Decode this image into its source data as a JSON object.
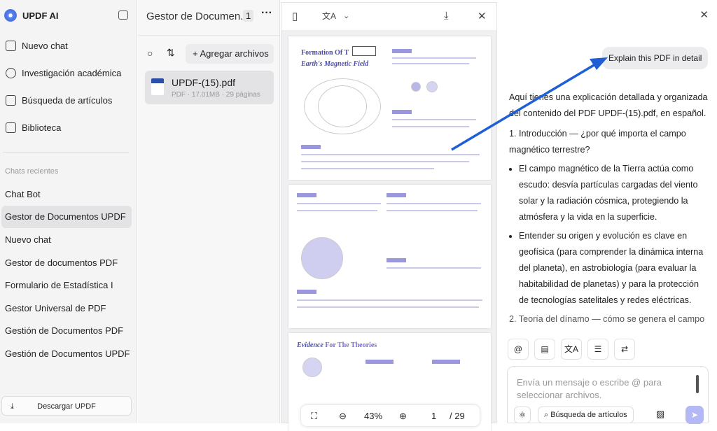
{
  "app": {
    "name": "UPDF AI"
  },
  "nav": [
    {
      "label": "Nuevo chat",
      "icon": "edit-icon"
    },
    {
      "label": "Investigación académica",
      "icon": "telescope-icon"
    },
    {
      "label": "Búsqueda de artículos",
      "icon": "search-doc-icon"
    },
    {
      "label": "Biblioteca",
      "icon": "library-icon"
    }
  ],
  "recent_heading": "Chats recientes",
  "recent": [
    "Chat Bot",
    "Gestor de Documentos UPDF",
    "Nuevo chat",
    "Gestor de documentos PDF",
    "Formulario de Estadística I",
    "Gestor Universal de PDF",
    "Gestión de Documentos PDF",
    "Gestión de Documentos UPDF"
  ],
  "download": "Descargar UPDF",
  "files": {
    "title": "Gestor de Documen...",
    "count": "1",
    "add": "Agregar archivos",
    "items": [
      {
        "name": "UPDF-(15).pdf",
        "meta": "PDF · 17.01MB · 29 páginas"
      }
    ]
  },
  "viewer": {
    "page1_title": "Formation Of T",
    "page1_subtitle": "Earth's Magnetic Field",
    "page3_title_a": "Evidence",
    "page3_title_b": "For The Theories",
    "zoom": "43%",
    "page": "1",
    "total": "/ 29"
  },
  "chat": {
    "user_msg": "Explain this PDF in detail",
    "intro": "Aquí tienes una explicación detallada y organizada del contenido del PDF UPDF-(15).pdf, en español.",
    "s1": "1. Introducción — ¿por qué importa el campo magnético terrestre?",
    "b1": "El campo magnético de la Tierra actúa como escudo: desvía partículas cargadas del viento solar y la radiación cósmica, protegiendo la atmósfera y la vida en la superficie.",
    "b2": "Entender su origen y evolución es clave en geofísica (para comprender la dinámica interna del planeta), en astrobiología (para evaluar la habitabilidad de planetas) y para la protección de tecnologías satelitales y redes eléctricas.",
    "s2": "2. Teoría del dínamo — cómo se genera el campo",
    "placeholder": "Envía un mensaje o escribe @ para seleccionar archivos.",
    "search_btn": "Búsqueda de artículos"
  },
  "colors": {
    "accent": "#1f5fd6",
    "send": "#b4b8f4"
  }
}
